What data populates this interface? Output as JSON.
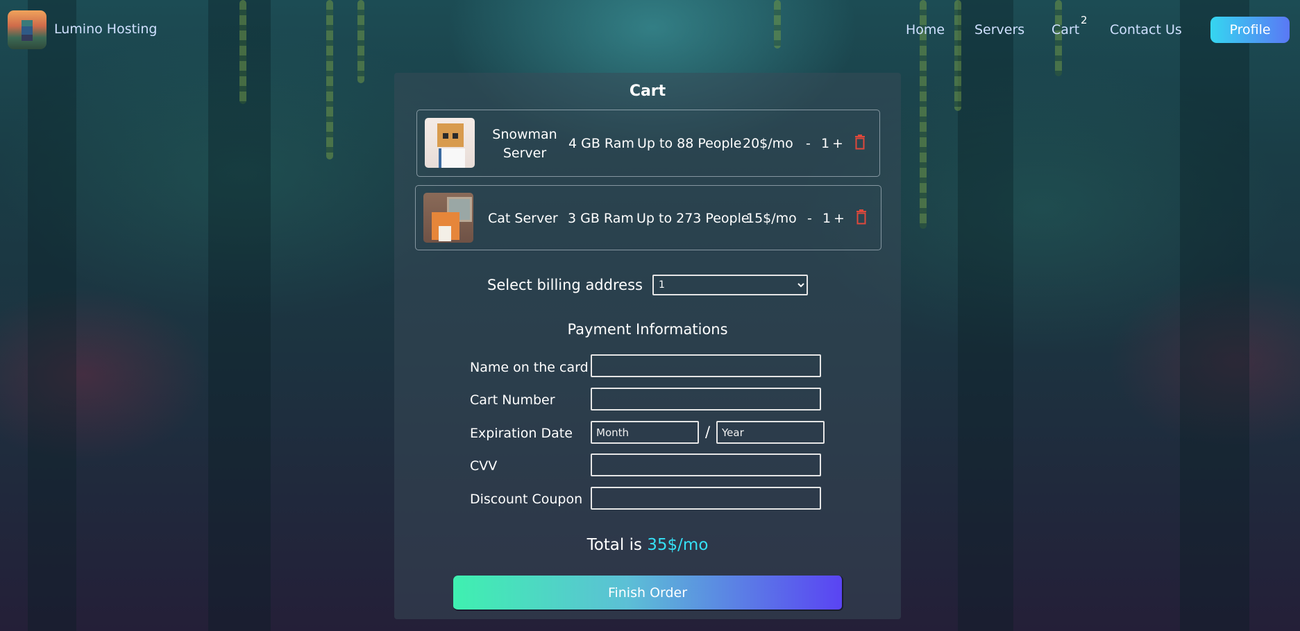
{
  "nav": {
    "brand": "Lumino Hosting",
    "links": [
      "Home",
      "Servers",
      "Cart",
      "Contact Us"
    ],
    "cart_count": "2",
    "profile": "Profile"
  },
  "cart": {
    "title": "Cart",
    "items": [
      {
        "name": "Snowman Server",
        "ram": "4 GB Ram",
        "people": "Up to 88 People",
        "price": "20$/mo",
        "minus": "-",
        "qty": "1",
        "plus": "+",
        "icon": "trash-icon"
      },
      {
        "name": "Cat Server",
        "ram": "3 GB Ram",
        "people": "Up to 273 People",
        "price": "15$/mo",
        "minus": "-",
        "qty": "1",
        "plus": "+",
        "icon": "trash-icon"
      }
    ]
  },
  "billing": {
    "label": "Select billing address",
    "selected": "1"
  },
  "payment": {
    "heading": "Payment Informations",
    "name_label": "Name on the card",
    "number_label": "Cart Number",
    "expiration_label": "Expiration Date",
    "month_placeholder": "Month",
    "separator": "/",
    "year_placeholder": "Year",
    "cvv_label": "CVV",
    "coupon_label": "Discount Coupon"
  },
  "total": {
    "prefix": "Total is ",
    "amount": "35$/mo"
  },
  "finish_button": "Finish Order",
  "colors": {
    "accent": "#35e0f5",
    "delete": "#e0483b",
    "button_start": "#3ff0b0",
    "button_end": "#5a44f3"
  }
}
